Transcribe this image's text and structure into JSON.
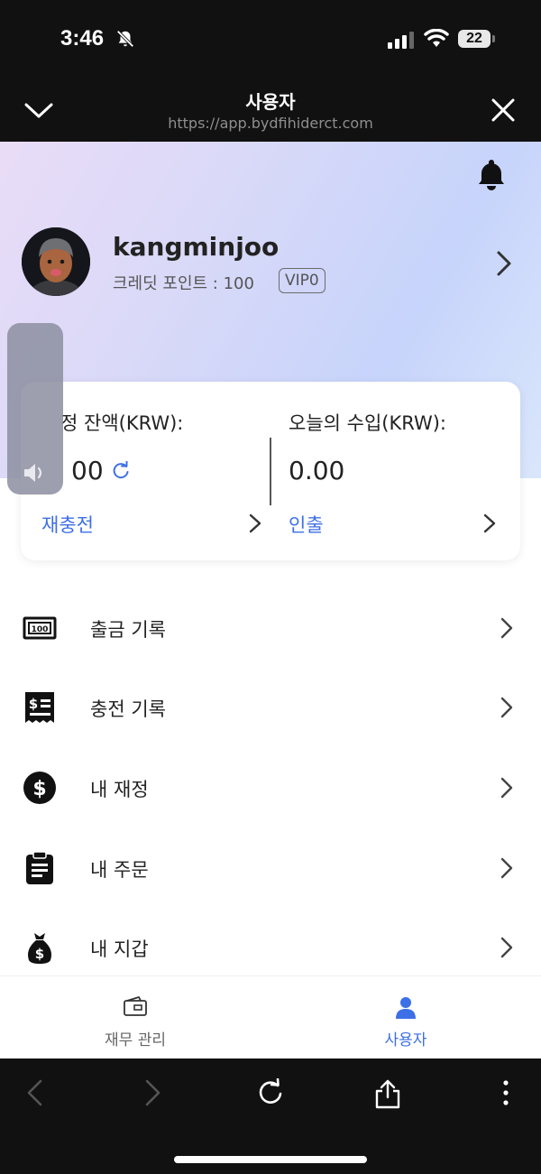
{
  "status_bar": {
    "time": "3:46",
    "battery": "22"
  },
  "header": {
    "title": "사용자",
    "url": "https://app.bydfihiderct.com"
  },
  "profile": {
    "username": "kangminjoo",
    "credit_label": "크레딧 포인트 : 100",
    "vip": "VIP0"
  },
  "balance_card": {
    "left_label": "정 잔액(KRW):",
    "left_value": "00",
    "left_link": "재충전",
    "right_label": "오늘의 수입(KRW):",
    "right_value": "0.00",
    "right_link": "인출"
  },
  "menu": {
    "items": [
      {
        "label": "출금 기록",
        "icon": "banknote-icon"
      },
      {
        "label": "충전 기록",
        "icon": "receipt-icon"
      },
      {
        "label": "내 재정",
        "icon": "dollar-circle-icon"
      },
      {
        "label": "내 주문",
        "icon": "clipboard-icon"
      },
      {
        "label": "내 지갑",
        "icon": "money-bag-icon"
      }
    ]
  },
  "tabbar": {
    "tabs": [
      {
        "label": "재무 관리",
        "active": false
      },
      {
        "label": "사용자",
        "active": true
      }
    ]
  },
  "colors": {
    "accent": "#3d6fe6",
    "dark_chrome": "#111111"
  }
}
